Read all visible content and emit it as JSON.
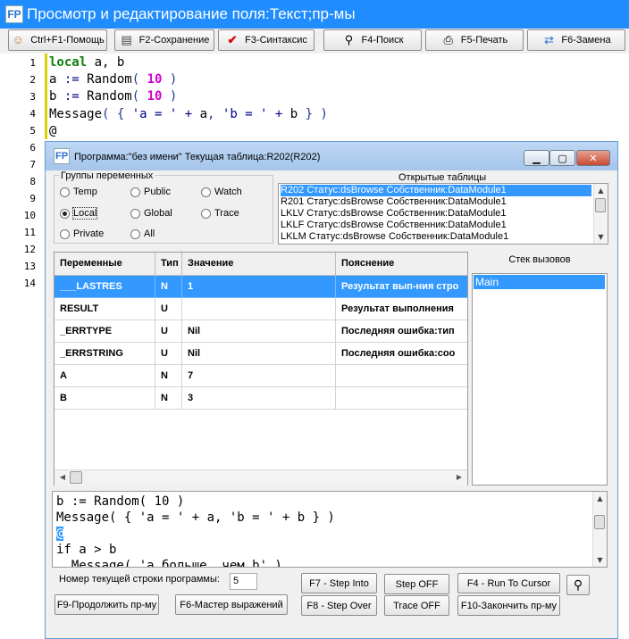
{
  "window": {
    "title": "Просмотр и редактирование поля:Текст;пр-мы",
    "logo": "FP"
  },
  "toolbar": [
    {
      "label": "Ctrl+F1-Помощь",
      "icon": "help-person-icon"
    },
    {
      "label": "F2-Сохранение",
      "icon": "save-icon"
    },
    {
      "label": "F3-Синтаксис",
      "icon": "checkmark-icon"
    },
    {
      "label": "F4-Поиск",
      "icon": "magnifier-icon"
    },
    {
      "label": "F5-Печать",
      "icon": "printer-icon"
    },
    {
      "label": "F6-Замена",
      "icon": "replace-icon"
    }
  ],
  "editor": {
    "line_numbers": [
      "1",
      "2",
      "3",
      "4",
      "5",
      "6",
      "7",
      "8",
      "9",
      "10",
      "11",
      "12",
      "13",
      "14"
    ],
    "lines": {
      "l1_kw": "local",
      "l1_rest": " a, b",
      "l2_a": "a ",
      "l2_op": ":=",
      "l2_fn": " Random",
      "l2_p1": "( ",
      "l2_num": "10",
      "l2_p2": " )",
      "l3_a": "b ",
      "l3_op": ":=",
      "l3_fn": " Random",
      "l3_p1": "( ",
      "l3_num": "10",
      "l3_p2": " )",
      "l4_fn": "Message",
      "l4_p1": "( { ",
      "l4_s1": "'a = '",
      "l4_op1": " + ",
      "l4_v1": "a",
      "l4_c": ", ",
      "l4_s2": "'b = '",
      "l4_op2": " + ",
      "l4_v2": "b",
      "l4_p2": " } )",
      "l5": "@"
    }
  },
  "debugger": {
    "title": "Программа:\"без имени\"   Текущая таблица:R202(R202)",
    "logo": "FP",
    "win_buttons": {
      "minimize": "▁",
      "maximize": "▢",
      "close": "✕"
    },
    "groups_label": "Группы переменных",
    "radios": [
      {
        "label": "Temp",
        "checked": false
      },
      {
        "label": "Public",
        "checked": false
      },
      {
        "label": "Watch",
        "checked": false
      },
      {
        "label": "Local",
        "checked": true
      },
      {
        "label": "Global",
        "checked": false
      },
      {
        "label": "Trace",
        "checked": false
      },
      {
        "label": "Private",
        "checked": false
      },
      {
        "label": "All",
        "checked": false
      }
    ],
    "open_tables_label": "Открытые таблицы",
    "open_tables": [
      "R202 Статус:dsBrowse Собственник:DataModule1",
      "R201 Статус:dsBrowse Собственник:DataModule1",
      "LKLV Статус:dsBrowse Собственник:DataModule1",
      "LKLF Статус:dsBrowse Собственник:DataModule1",
      "LKLM Статус:dsBrowse Собственник:DataModule1"
    ],
    "grid": {
      "headers": [
        "Переменные",
        "Тип",
        "Значение",
        "Пояснение"
      ],
      "rows": [
        [
          "___LASTRES",
          "N",
          "1",
          "Результат вып-ния стро"
        ],
        [
          "RESULT",
          "U",
          "",
          "Результат выполнения"
        ],
        [
          "_ERRTYPE",
          "U",
          "Nil",
          "Последняя ошибка:тип"
        ],
        [
          "_ERRSTRING",
          "U",
          "Nil",
          "Последняя ошибка:соо"
        ],
        [
          "A",
          "N",
          "7",
          ""
        ],
        [
          "B",
          "N",
          "3",
          ""
        ]
      ]
    },
    "call_stack_label": "Стек вызовов",
    "call_stack": [
      "Main"
    ],
    "preview": {
      "l1": "b := Random( 10 )",
      "l2": "Message( { 'a = ' + a, 'b = ' + b } )",
      "l3": "@",
      "l4": "if a > b",
      "l5": "  Message( 'a больше, чем b' )"
    },
    "line_label": "Номер текущей строки программы:",
    "line_value": "5",
    "buttons": {
      "step_into": "F7 - Step Into",
      "step_off": "Step OFF",
      "run_to_cursor": "F4 - Run To Cursor",
      "continue": "F9-Продолжить пр-му",
      "expr_master": "F6-Мастер выражений",
      "step_over": "F8 - Step Over",
      "trace_off": "Trace OFF",
      "finish": "F10-Закончить пр-му"
    }
  }
}
